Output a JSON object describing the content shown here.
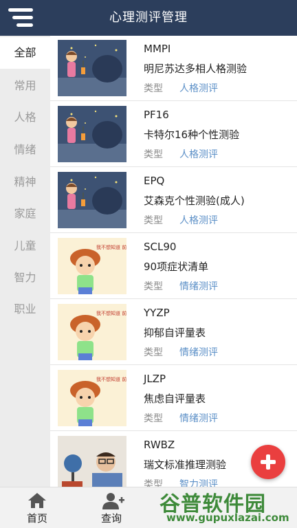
{
  "header": {
    "title": "心理测评管理",
    "menu_icon": "hamburger-menu-icon"
  },
  "sidebar": {
    "items": [
      {
        "label": "全部",
        "active": true
      },
      {
        "label": "常用",
        "active": false
      },
      {
        "label": "人格",
        "active": false
      },
      {
        "label": "情绪",
        "active": false
      },
      {
        "label": "精神",
        "active": false
      },
      {
        "label": "家庭",
        "active": false
      },
      {
        "label": "儿童",
        "active": false
      },
      {
        "label": "智力",
        "active": false
      },
      {
        "label": "职业",
        "active": false
      }
    ]
  },
  "tests": [
    {
      "code": "MMPI",
      "name": "明尼苏达多相人格测验",
      "type_label": "类型",
      "type": "人格测评",
      "thumb": "night-girl-lantern"
    },
    {
      "code": "PF16",
      "name": "卡特尔16种个性测验",
      "type_label": "类型",
      "type": "人格测评",
      "thumb": "night-girl-lantern"
    },
    {
      "code": "EPQ",
      "name": "艾森克个性测验(成人)",
      "type_label": "类型",
      "type": "人格测评",
      "thumb": "night-girl-lantern"
    },
    {
      "code": "SCL90",
      "name": "90项症状清单",
      "type_label": "类型",
      "type": "情绪测评",
      "thumb": "worried-boy-cartoon",
      "thumb_text": "我不想知道 前途真不"
    },
    {
      "code": "YYZP",
      "name": "抑郁自评量表",
      "type_label": "类型",
      "type": "情绪测评",
      "thumb": "worried-boy-cartoon",
      "thumb_text": "我不想知道 前途真不"
    },
    {
      "code": "JLZP",
      "name": "焦虑自评量表",
      "type_label": "类型",
      "type": "情绪测评",
      "thumb": "worried-boy-cartoon",
      "thumb_text": "我不想知道 前途真不"
    },
    {
      "code": "RWBZ",
      "name": "瑞文标准推理测验",
      "type_label": "类型",
      "type": "智力测评",
      "thumb": "boy-with-globe-photo"
    }
  ],
  "fab": {
    "icon": "plus-icon",
    "color": "#ea3f3f"
  },
  "tabbar": {
    "tabs": [
      {
        "label": "首页",
        "icon": "home-icon"
      },
      {
        "label": "查询",
        "icon": "add-user-icon"
      }
    ]
  },
  "watermark": {
    "main": "谷普软件园",
    "sub": "www.gupuxlazai.com"
  },
  "colors": {
    "header_bg": "#2c3e5c",
    "type_blue": "#5b8fc7",
    "sidebar_bg": "#ececec"
  }
}
